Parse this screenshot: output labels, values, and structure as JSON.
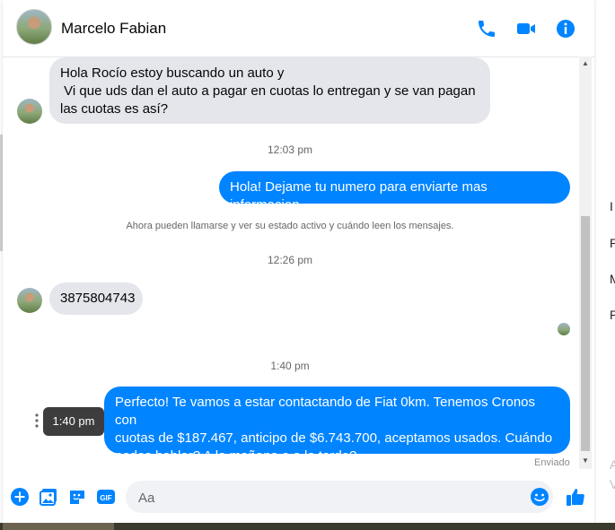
{
  "header": {
    "contact_name": "Marcelo Fabian"
  },
  "messages": [
    {
      "type": "incoming",
      "lines": [
        "Hola Rocío estoy buscando un auto y",
        " Vi que uds dan el auto a pagar en cuotas lo entregan y se van pagan",
        "las cuotas es así?"
      ]
    },
    {
      "type": "timestamp",
      "text": "12:03 pm"
    },
    {
      "type": "outgoing",
      "text": "Hola! Dejame tu numero para enviarte mas informacion"
    },
    {
      "type": "system",
      "text": "Ahora pueden llamarse y ver su estado activo y cuándo leen los mensajes."
    },
    {
      "type": "timestamp",
      "text": "12:26 pm"
    },
    {
      "type": "incoming",
      "text": "3875804743"
    },
    {
      "type": "timestamp",
      "text": "1:40 pm"
    },
    {
      "type": "outgoing",
      "lines": [
        "Perfecto! Te vamos a estar contactando de Fiat 0km. Tenemos Cronos con",
        "cuotas de $187.467, anticipo de $6.743.700, aceptamos usados. Cuándo",
        "podes hablar? A la mañana o a la tarde?"
      ]
    }
  ],
  "tooltip": "1:40 pm",
  "status": "Enviado",
  "composer": {
    "placeholder": "Aa"
  },
  "icons": {
    "header": [
      "phone-icon",
      "video-icon",
      "info-icon"
    ],
    "composer": [
      "plus-icon",
      "image-icon",
      "sticker-icon",
      "gif-icon",
      "emoji-icon",
      "like-icon"
    ]
  },
  "background_letters": [
    "I",
    "P",
    "M",
    "P",
    "A",
    "V"
  ],
  "colors": {
    "accent": "#0084ff",
    "incoming_bubble": "#e4e6eb",
    "muted_text": "#65676b"
  }
}
